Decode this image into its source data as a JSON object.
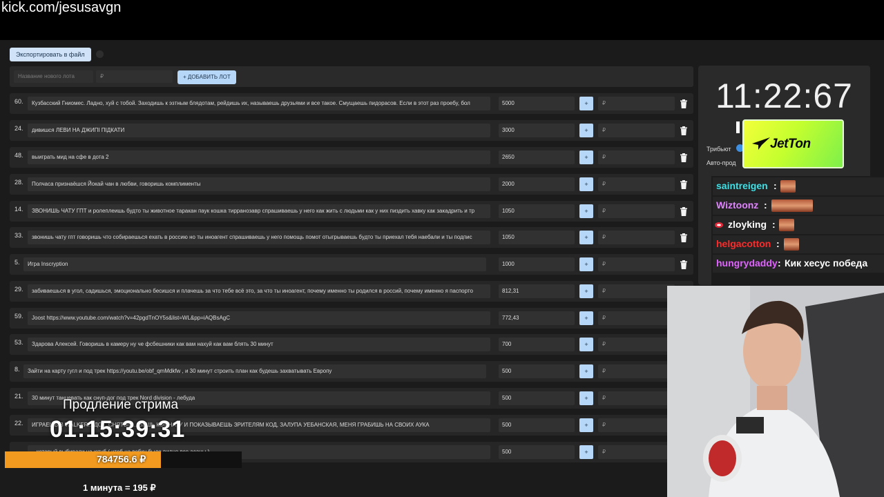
{
  "url": "kick.com/jesusavgn",
  "toolbar": {
    "export_label": "Экспортировать в файл"
  },
  "add_lot": {
    "name_placeholder": "Название нового лота",
    "rub_placeholder": "₽",
    "add_label": "+ ДОБАВИТЬ ЛОТ"
  },
  "lots": [
    {
      "num": "60.",
      "text": "Кузбасский Гниомес. Ладно, хуй с тобой. Заходишь к эзтным блядотам, рейдишь их, называешь друзьями и все такое. Смущаешь пидорасов. Если в этот раз проебу, бол",
      "amount": "5000",
      "plus": "+",
      "rub": "₽"
    },
    {
      "num": "24.",
      "text": "дивишся ЛЕВИ НА ДЖИПІ ПІДКАТИ",
      "amount": "3000",
      "plus": "+",
      "rub": "₽"
    },
    {
      "num": "48.",
      "text": "выиграть мид на сфе в дота 2",
      "amount": "2650",
      "plus": "+",
      "rub": "₽"
    },
    {
      "num": "28.",
      "text": "Полчаса признаёшся Йокай чан в любви, говоришь комплименты",
      "amount": "2000",
      "plus": "+",
      "rub": "₽"
    },
    {
      "num": "14.",
      "text": "ЗВОНИШЬ ЧАТУ ГПТ и ролеплеишь будто ты животное таракан паук кошка тирранозавр спрашиваешь у него как жить с людьми как у них пиздить хавку как закадрить и тр",
      "amount": "1050",
      "plus": "+",
      "rub": "₽"
    },
    {
      "num": "33.",
      "text": "звонишь чату гпт говоришь что собираешься ехать в россию но ты иноагент спрашиваешь у него помощь помот отыгрываешь будто ты приехал тебя наебали и ты подпис",
      "amount": "1050",
      "plus": "+",
      "rub": "₽"
    },
    {
      "num": "5.",
      "text": "Игра Inscryption",
      "amount": "1000",
      "plus": "+",
      "rub": "₽"
    },
    {
      "num": "29.",
      "text": "забиваешься в угол, садишься, эмоционально бесишся и плачешь за что тебе всё это, за что ты иноагент, почему именно ты родился в россий, почему именно я паспорто",
      "amount": "812,31",
      "plus": "+",
      "rub": "₽"
    },
    {
      "num": "59.",
      "text": "Joost https://www.youtube.com/watch?v=42pgdTnOY5s&list=WL&pp=iAQBsAgC",
      "amount": "772,43",
      "plus": "+",
      "rub": "₽"
    },
    {
      "num": "53.",
      "text": "Здарова Алексей. Говоришь в камеру ну че фсбешники как вам нахуй как вам блять 30 минут",
      "amount": "700",
      "plus": "+",
      "rub": "₽"
    },
    {
      "num": "8.",
      "text": "Зайти на карту гугл и под трек https://youtu.be/obf_qmMdkfw , и 30 минут строить план как будешь захватывать Европу",
      "amount": "500",
      "plus": "+",
      "rub": "₽"
    },
    {
      "num": "21.",
      "text": "30 минут танцевать как снуп-дог под трек Nord division - лебуда",
      "amount": "500",
      "plus": "+",
      "rub": "₽"
    },
    {
      "num": "22.",
      "text": "ИГРАЕШЬ В WALKER... ДО... СНЯТЫЙ... ВЕШЬ КОМНАТУ И ПОКАЗЫВАЕШЬ ЗРИТЕЛЯМ КОД, ЗАЛУПА УЕБАНСКАЯ, МЕНЯ ГРАБИШЬ НА СВОИХ АУКА",
      "amount": "500",
      "plus": "+",
      "rub": "₽"
    },
    {
      "num": "",
      "text": "...который выбирали на ютуб ( чтоб на вебку было видно все асаны )",
      "amount": "500",
      "plus": "+",
      "rub": "₽"
    }
  ],
  "timer": {
    "value": "11:22:67",
    "tribute_label": "Трибьют",
    "auto_label": "Авто-прод"
  },
  "sponsor": {
    "text": "JetTon",
    "color": "#c6ff2e"
  },
  "chat": [
    {
      "name": "saintreigen",
      "color": "#3fe0e6",
      "message": ""
    },
    {
      "name": "Wiztoonz",
      "color": "#e083ff",
      "message": ""
    },
    {
      "name": "zloyking",
      "color": "#ffffff",
      "message": ""
    },
    {
      "name": "helgacotton",
      "color": "#ff2a2a",
      "message": ""
    },
    {
      "name": "hungrydaddy",
      "color": "#e063ff",
      "message": "Кик хесус победа"
    }
  ],
  "chat_separator": ":",
  "extension": {
    "title": "Продление стрима",
    "timer": "01:15:39:31",
    "total": "784756.6 ₽",
    "progress": 0.66,
    "rate": "1 минута = 195 ₽"
  },
  "colors": {
    "accent": "#b6d7f7",
    "progress": "#f29a1f"
  }
}
